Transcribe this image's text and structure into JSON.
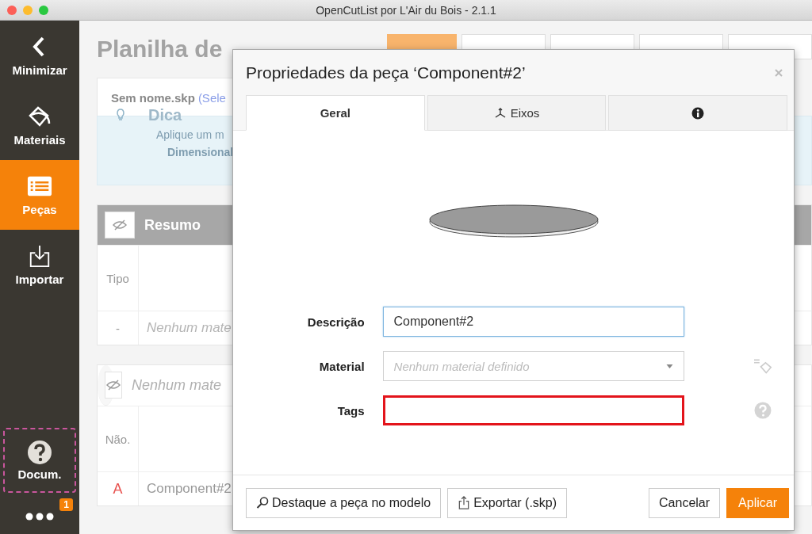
{
  "window": {
    "title": "OpenCutList por L'Air du Bois - 2.1.1"
  },
  "sidebar": {
    "items": [
      {
        "label": "Minimizar",
        "selected": false
      },
      {
        "label": "Materiais",
        "selected": false
      },
      {
        "label": "Peças",
        "selected": true
      },
      {
        "label": "Importar",
        "selected": false
      }
    ],
    "help": {
      "label": "Docum."
    },
    "more": {
      "badge": "1"
    }
  },
  "page": {
    "title": "Planilha de",
    "toolbar": [
      {
        "kind": "primary"
      },
      {
        "kind": "plain"
      },
      {
        "kind": "plain"
      },
      {
        "kind": "plain"
      },
      {
        "kind": "plain"
      }
    ],
    "file": {
      "name": "Sem nome.skp",
      "selection": "(Sele"
    },
    "tip": {
      "title": "Dica",
      "lines": [
        "Aplique um m",
        "Dimensional"
      ]
    },
    "summary": {
      "title": "Resumo",
      "header": "Tipo",
      "rows": [
        {
          "column_1": "-",
          "column_2": "Nenhum mate"
        }
      ]
    },
    "group": {
      "title": "Nenhum mate",
      "header": "Não.",
      "rows": [
        {
          "column_1": "A",
          "column_2": "Component#2"
        }
      ]
    }
  },
  "dialog": {
    "title": "Propriedades da peça ‘Component#2’",
    "tabs": [
      {
        "label": "Geral",
        "selected": true
      },
      {
        "label": "Eixos",
        "selected": false
      },
      {
        "selected": false
      }
    ],
    "fields": [
      {
        "label": "Descrição",
        "kind": "text",
        "value": "Component#2",
        "focused": true,
        "invalid": false
      },
      {
        "label": "Material",
        "kind": "select",
        "placeholder": "Nenhum material definido",
        "focused": false,
        "invalid": false
      },
      {
        "label": "Tags",
        "kind": "text",
        "focused": false,
        "invalid": true
      }
    ],
    "buttons": [
      {
        "label": "Destaque a peça no modelo",
        "kind": "default"
      },
      {
        "label": "Exportar (.skp)",
        "kind": "default"
      },
      {
        "label": "Cancelar",
        "kind": "default"
      },
      {
        "label": "Aplicar",
        "kind": "primary"
      }
    ]
  }
}
